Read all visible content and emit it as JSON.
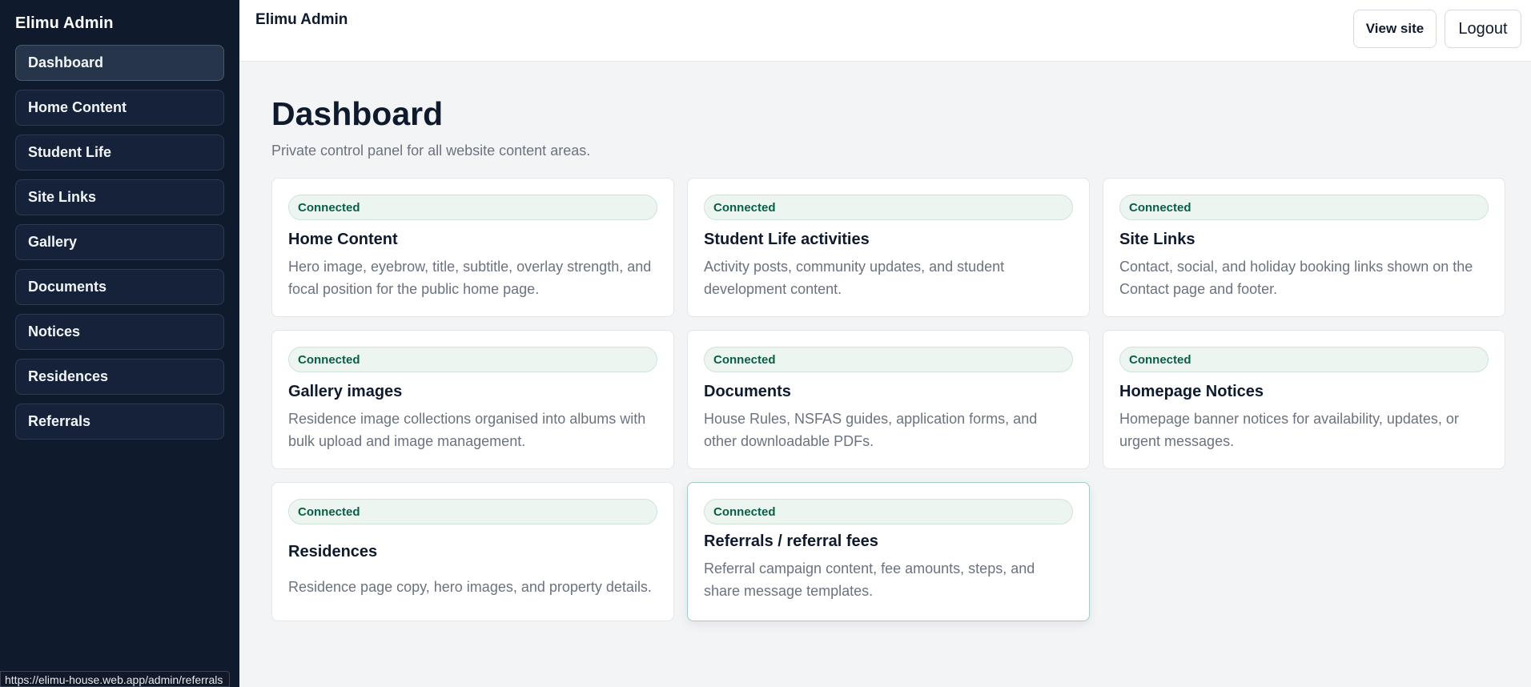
{
  "sidebar": {
    "brand": "Elimu Admin",
    "items": [
      {
        "label": "Dashboard"
      },
      {
        "label": "Home Content"
      },
      {
        "label": "Student Life"
      },
      {
        "label": "Site Links"
      },
      {
        "label": "Gallery"
      },
      {
        "label": "Documents"
      },
      {
        "label": "Notices"
      },
      {
        "label": "Residences"
      },
      {
        "label": "Referrals"
      }
    ],
    "active_item": "Dashboard"
  },
  "topbar": {
    "title": "Elimu Admin",
    "view_site_label": "View site",
    "logout_label": "Logout"
  },
  "main": {
    "title": "Dashboard",
    "subtitle": "Private control panel for all website content areas.",
    "cards": [
      {
        "status": "Connected",
        "title": "Home Content",
        "description": "Hero image, eyebrow, title, subtitle, overlay strength, and focal position for the public home page."
      },
      {
        "status": "Connected",
        "title": "Student Life activities",
        "description": "Activity posts, community updates, and student development content."
      },
      {
        "status": "Connected",
        "title": "Site Links",
        "description": "Contact, social, and holiday booking links shown on the Contact page and footer."
      },
      {
        "status": "Connected",
        "title": "Gallery images",
        "description": "Residence image collections organised into albums with bulk upload and image management."
      },
      {
        "status": "Connected",
        "title": "Documents",
        "description": "House Rules, NSFAS guides, application forms, and other downloadable PDFs."
      },
      {
        "status": "Connected",
        "title": "Homepage Notices",
        "description": "Homepage banner notices for availability, updates, or urgent messages."
      },
      {
        "status": "Connected",
        "title": "Residences",
        "description": "Residence page copy, hero images, and property details."
      },
      {
        "status": "Connected",
        "title": "Referrals / referral fees",
        "description": "Referral campaign content, fee amounts, steps, and share message templates."
      }
    ]
  },
  "status_bar": {
    "url": "https://elimu-house.web.app/admin/referrals"
  },
  "colors": {
    "sidebar_bg": "#0f1b2d",
    "page_bg": "#f3f4f6",
    "badge_text": "#065f46",
    "badge_bg": "#edf5f1"
  }
}
